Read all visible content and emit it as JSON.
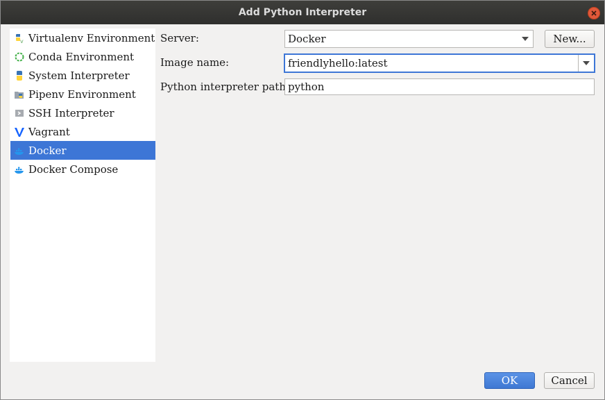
{
  "window": {
    "title": "Add Python Interpreter"
  },
  "sidebar": {
    "items": [
      {
        "label": "Virtualenv Environment",
        "icon": "python-virtualenv-icon"
      },
      {
        "label": "Conda Environment",
        "icon": "conda-icon"
      },
      {
        "label": "System Interpreter",
        "icon": "python-icon"
      },
      {
        "label": "Pipenv Environment",
        "icon": "pipenv-icon"
      },
      {
        "label": "SSH Interpreter",
        "icon": "ssh-icon"
      },
      {
        "label": "Vagrant",
        "icon": "vagrant-icon"
      },
      {
        "label": "Docker",
        "icon": "docker-icon",
        "selected": true
      },
      {
        "label": "Docker Compose",
        "icon": "docker-compose-icon"
      }
    ]
  },
  "form": {
    "server_label": "Server:",
    "server_value": "Docker",
    "new_button": "New...",
    "image_label": "Image name:",
    "image_value": "friendlyhello:latest",
    "path_label": "Python interpreter path:",
    "path_value": "python"
  },
  "buttons": {
    "ok": "OK",
    "cancel": "Cancel"
  },
  "colors": {
    "accent": "#3d76d6",
    "titlebar": "#3a3a37",
    "close": "#e0583a"
  }
}
